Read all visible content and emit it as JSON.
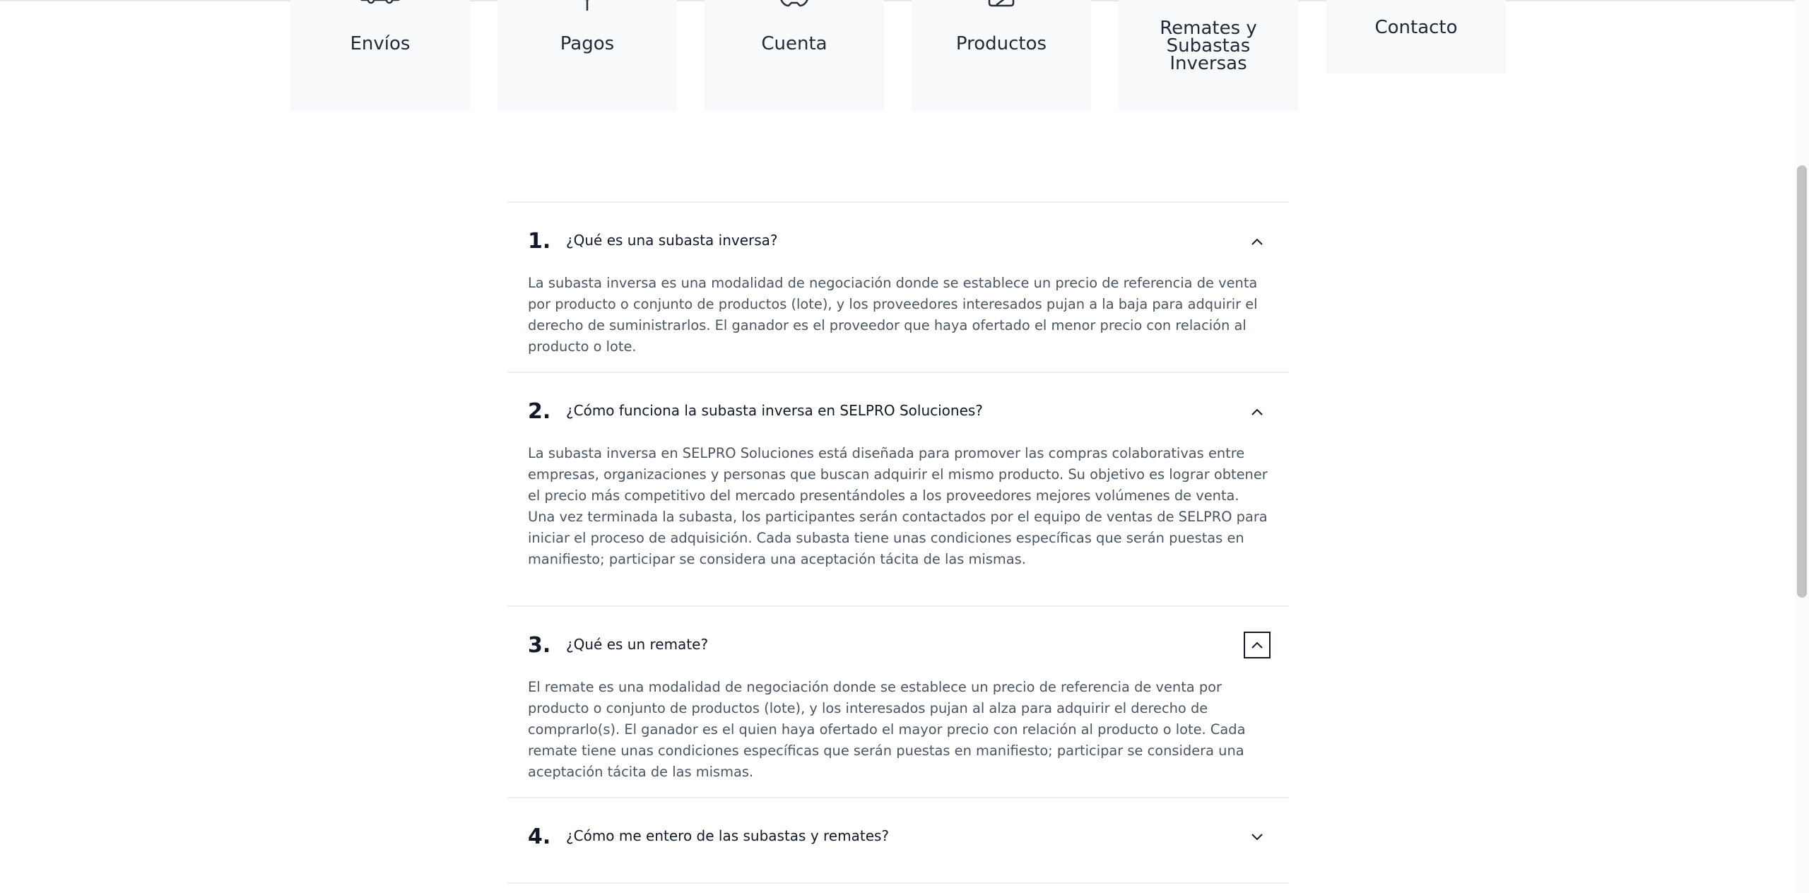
{
  "categories": [
    {
      "label": "Envíos",
      "icon": "truck-icon"
    },
    {
      "label": "Pagos",
      "icon": "wallet-icon"
    },
    {
      "label": "Cuenta",
      "icon": "user-gear-icon"
    },
    {
      "label": "Productos",
      "icon": "box-icon"
    },
    {
      "label": "Remates y Subastas Inversas"
    },
    {
      "label": "Contacto"
    }
  ],
  "faqs": [
    {
      "number": "1.",
      "question": "¿Qué es una subasta inversa?",
      "expanded": true,
      "answer": "La subasta inversa es una modalidad de negociación donde se establece un precio de referencia de venta por producto o conjunto de productos (lote), y los proveedores interesados pujan a la baja para adquirir el derecho de suministrarlos. El ganador es el proveedor que haya ofertado el menor precio con relación al producto o lote."
    },
    {
      "number": "2.",
      "question": "¿Cómo funciona la subasta inversa en SELPRO Soluciones?",
      "expanded": true,
      "answer": "La subasta inversa en SELPRO Soluciones está diseñada para promover las compras colaborativas entre empresas, organizaciones y personas que buscan adquirir el mismo producto. Su objetivo es lograr obtener el precio más competitivo del mercado presentándoles a los proveedores mejores volúmenes de venta. Una vez terminada la subasta, los participantes serán contactados por el equipo de ventas de SELPRO para iniciar el proceso de adquisición. Cada subasta tiene unas condiciones específicas que serán puestas en manifiesto; participar se considera una aceptación tácita de las mismas."
    },
    {
      "number": "3.",
      "question": "¿Qué es un remate?",
      "expanded": true,
      "answer": "El remate es una modalidad de negociación donde se establece un precio de referencia de venta por producto o conjunto de productos (lote), y los interesados pujan al alza para adquirir el derecho de comprarlo(s). El ganador es el quien haya ofertado el mayor precio con relación al producto o lote. Cada remate tiene unas condiciones específicas que serán puestas en manifiesto; participar se considera una aceptación tácita de las mismas."
    },
    {
      "number": "4.",
      "question": "¿Cómo me entero de las subastas y remates?",
      "expanded": false
    }
  ],
  "colors": {
    "card_bg": "#f8f9fb",
    "text": "#111827",
    "body_text": "#4b5563",
    "divider": "#edf0f3"
  }
}
